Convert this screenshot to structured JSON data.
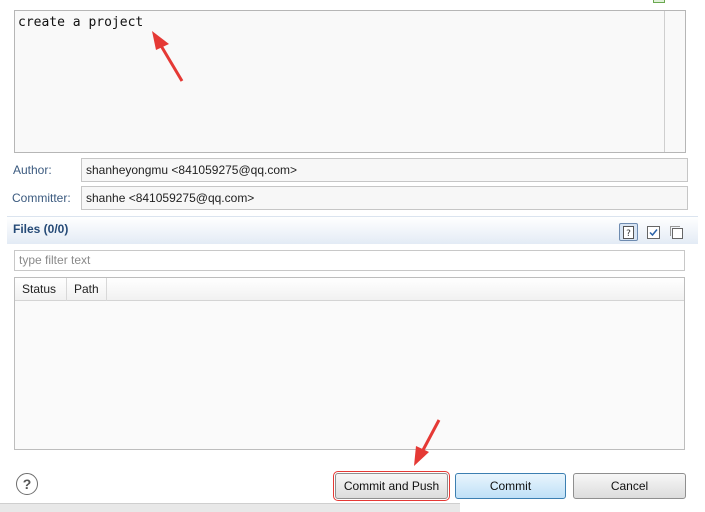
{
  "commit": {
    "message": "create a project"
  },
  "author": {
    "label": "Author:",
    "value": "shanheyongmu <841059275@qq.com>"
  },
  "committer": {
    "label": "Committer:",
    "value": "shanhe <841059275@qq.com>"
  },
  "files": {
    "title": "Files (0/0)",
    "filter_placeholder": "type filter text",
    "columns": [
      "Status",
      "Path"
    ],
    "toolbar_icons": [
      "help-toggle-icon",
      "check-all-icon",
      "uncheck-all-icon"
    ]
  },
  "buttons": {
    "help_symbol": "?",
    "commit_and_push": "Commit and Push",
    "commit": "Commit",
    "cancel": "Cancel"
  },
  "colors": {
    "annotation_arrow": "#e53935",
    "label_blue": "#3b5a7f",
    "files_title": "#254a77"
  }
}
